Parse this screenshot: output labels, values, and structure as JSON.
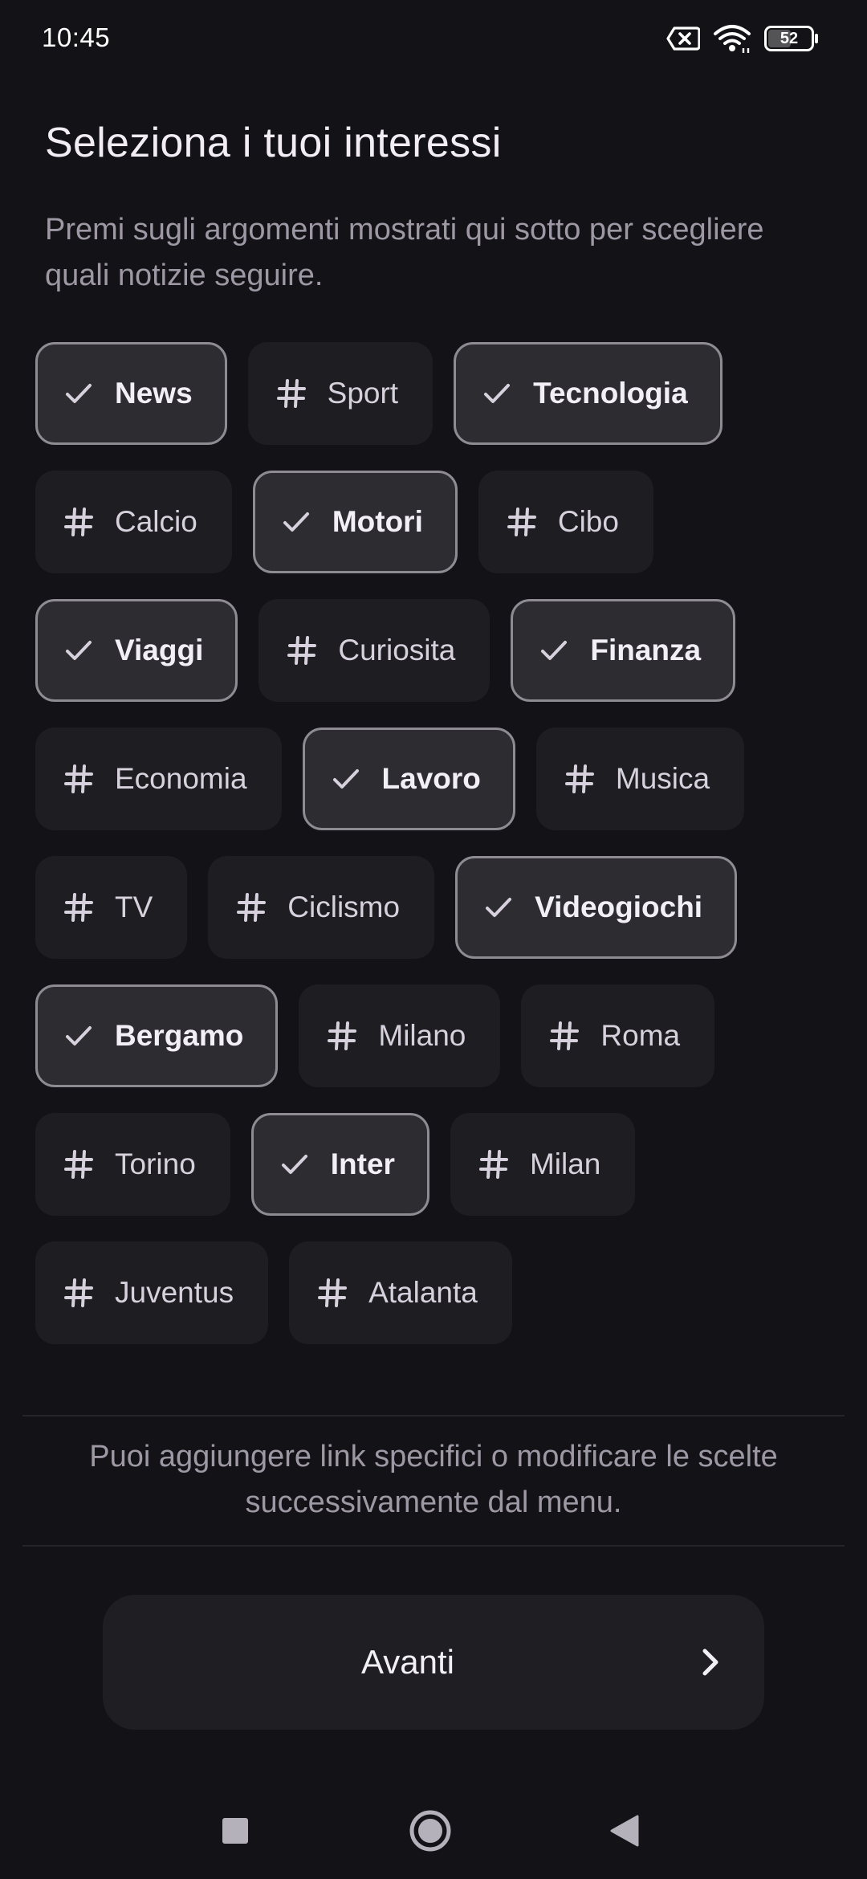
{
  "status_bar": {
    "time": "10:45",
    "battery_level": "52",
    "icons": [
      "no-sim-icon",
      "wifi-icon",
      "battery-icon"
    ]
  },
  "header": {
    "title": "Seleziona i tuoi interessi",
    "subtitle": "Premi sugli argomenti mostrati qui sotto per scegliere quali notizie seguire."
  },
  "topics": [
    {
      "label": "News",
      "selected": true
    },
    {
      "label": "Sport",
      "selected": false
    },
    {
      "label": "Tecnologia",
      "selected": true
    },
    {
      "label": "Calcio",
      "selected": false
    },
    {
      "label": "Motori",
      "selected": true
    },
    {
      "label": "Cibo",
      "selected": false
    },
    {
      "label": "Viaggi",
      "selected": true
    },
    {
      "label": "Curiosita",
      "selected": false
    },
    {
      "label": "Finanza",
      "selected": true
    },
    {
      "label": "Economia",
      "selected": false
    },
    {
      "label": "Lavoro",
      "selected": true
    },
    {
      "label": "Musica",
      "selected": false
    },
    {
      "label": "TV",
      "selected": false
    },
    {
      "label": "Ciclismo",
      "selected": false
    },
    {
      "label": "Videogiochi",
      "selected": true
    },
    {
      "label": "Bergamo",
      "selected": true
    },
    {
      "label": "Milano",
      "selected": false
    },
    {
      "label": "Roma",
      "selected": false
    },
    {
      "label": "Torino",
      "selected": false
    },
    {
      "label": "Inter",
      "selected": true
    },
    {
      "label": "Milan",
      "selected": false
    },
    {
      "label": "Juventus",
      "selected": false
    },
    {
      "label": "Atalanta",
      "selected": false
    }
  ],
  "icons": {
    "selected": "check-icon",
    "unselected": "hashtag-icon"
  },
  "info_text": "Puoi aggiungere link specifici o modificare le scelte successivamente dal menu.",
  "next_button": {
    "label": "Avanti",
    "icon": "chevron-right-icon"
  },
  "nav_bar": {
    "buttons": [
      "recents-icon",
      "home-icon",
      "back-icon"
    ]
  },
  "colors": {
    "background": "#131317",
    "chip": "#1e1e22",
    "chip_selected": "#2c2c31",
    "chip_selected_border": "#8e8b93",
    "secondary_text": "#9d98a4"
  }
}
